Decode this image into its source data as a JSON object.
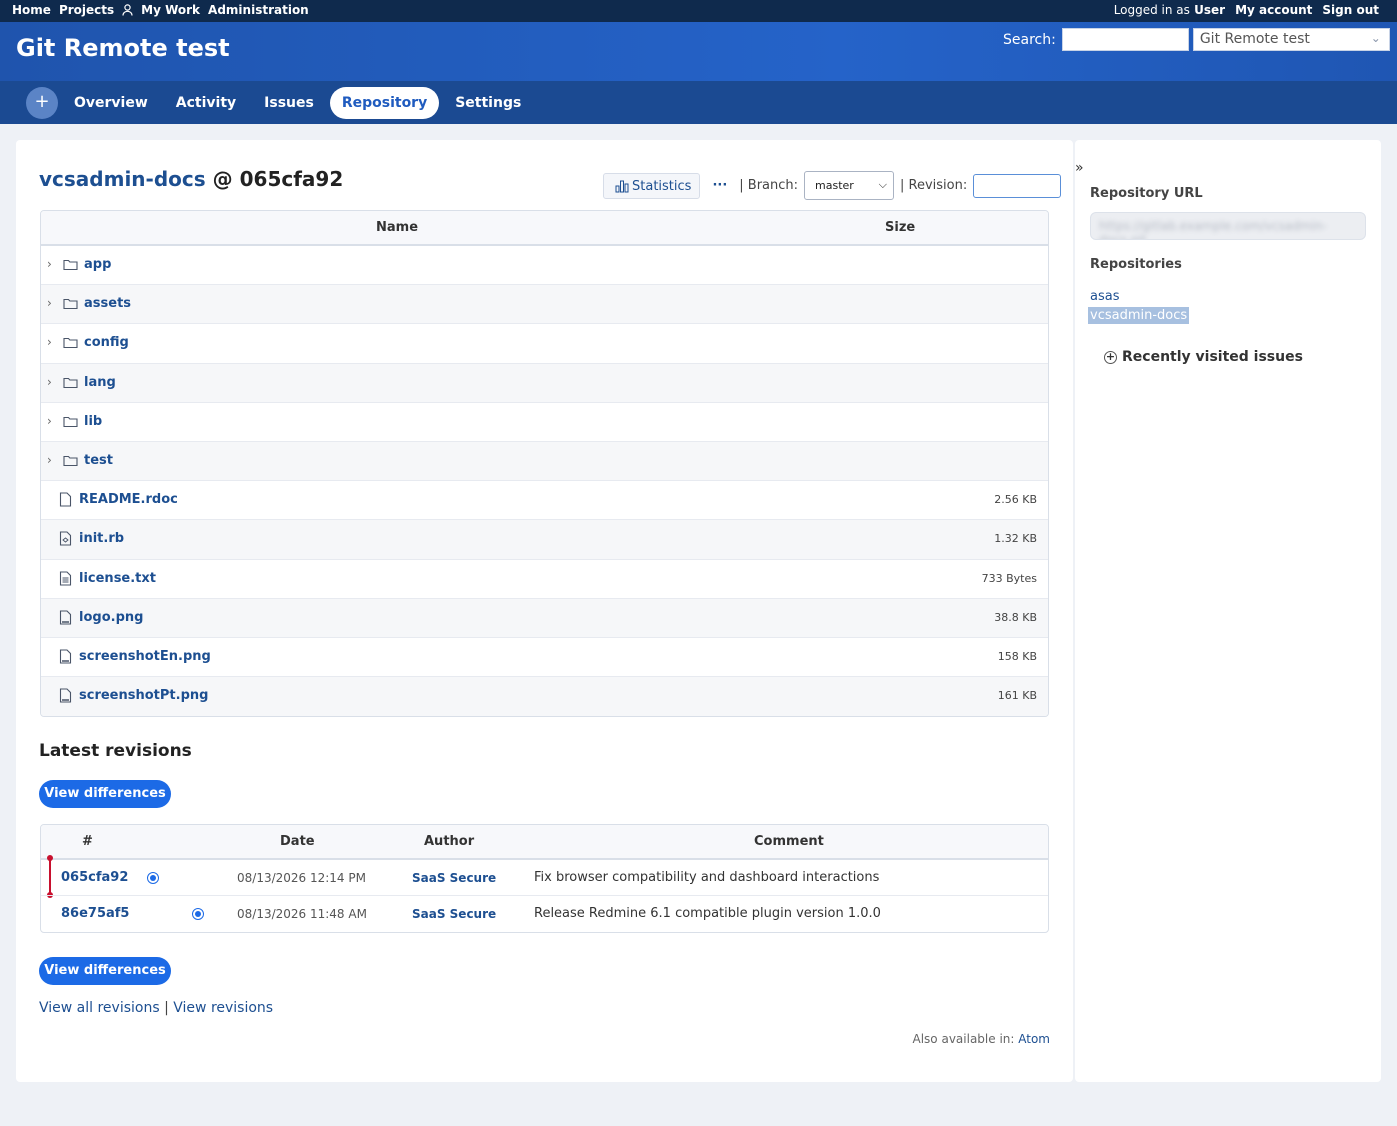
{
  "top_menu": {
    "left": [
      "Home",
      "Projects",
      "My Work",
      "Administration"
    ],
    "logged_in_as": "Logged in as",
    "user": "User",
    "my_account": "My account",
    "sign_out": "Sign out"
  },
  "header": {
    "title": "Git Remote test",
    "search_label": "Search:",
    "project_jump": "Git Remote test"
  },
  "main_menu": {
    "plus": "+",
    "tabs": [
      "Overview",
      "Activity",
      "Issues",
      "Repository",
      "Settings"
    ],
    "selected": "Repository"
  },
  "repository": {
    "name": "vcsadmin-docs",
    "at": "@",
    "revision": "065cfa92",
    "statistics": "Statistics",
    "more": "···",
    "branch_label": "| Branch:",
    "branch_value": "master",
    "revision_label": "| Revision:"
  },
  "files": {
    "header_name": "Name",
    "header_size": "Size",
    "dirs": [
      "app",
      "assets",
      "config",
      "lang",
      "lib",
      "test"
    ],
    "items": [
      {
        "name": "README.rdoc",
        "size": "2.56 KB",
        "icon": "text-file-icon"
      },
      {
        "name": "init.rb",
        "size": "1.32 KB",
        "icon": "ruby-file-icon"
      },
      {
        "name": "license.txt",
        "size": "733 Bytes",
        "icon": "text-file-icon"
      },
      {
        "name": "logo.png",
        "size": "38.8 KB",
        "icon": "png-file-icon"
      },
      {
        "name": "screenshotEn.png",
        "size": "158 KB",
        "icon": "png-file-icon"
      },
      {
        "name": "screenshotPt.png",
        "size": "161 KB",
        "icon": "png-file-icon"
      }
    ]
  },
  "revisions": {
    "title": "Latest revisions",
    "view_differences": "View differences",
    "headers": [
      "#",
      "Date",
      "Author",
      "Comment"
    ],
    "rows": [
      {
        "id": "065cfa92",
        "date": "08/13/2026 12:14 PM",
        "author": "SaaS Secure",
        "comment": "Fix browser compatibility and dashboard interactions"
      },
      {
        "id": "86e75af5",
        "date": "08/13/2026 11:48 AM",
        "author": "SaaS Secure",
        "comment": "Release Redmine 6.1 compatible plugin version 1.0.0"
      }
    ],
    "view_all": "View all revisions",
    "separator": "|",
    "view_revisions": "View revisions",
    "also_available": "Also available in:",
    "atom": "Atom"
  },
  "sidebar": {
    "collapse": "»",
    "repository_url_title": "Repository URL",
    "repository_url": "https://gitlab.example.com/vcsadmin-docs.git",
    "repositories_title": "Repositories",
    "repositories": [
      "asas",
      "vcsadmin-docs"
    ],
    "recent_issues": "Recently visited issues",
    "recent_toggle": "+"
  },
  "colors": {
    "header_blue": "#2563c9",
    "menu_blue": "#1b4a92",
    "accent": "#1c6ae6",
    "link": "#1d4f91",
    "graph_red": "#c8102e"
  }
}
